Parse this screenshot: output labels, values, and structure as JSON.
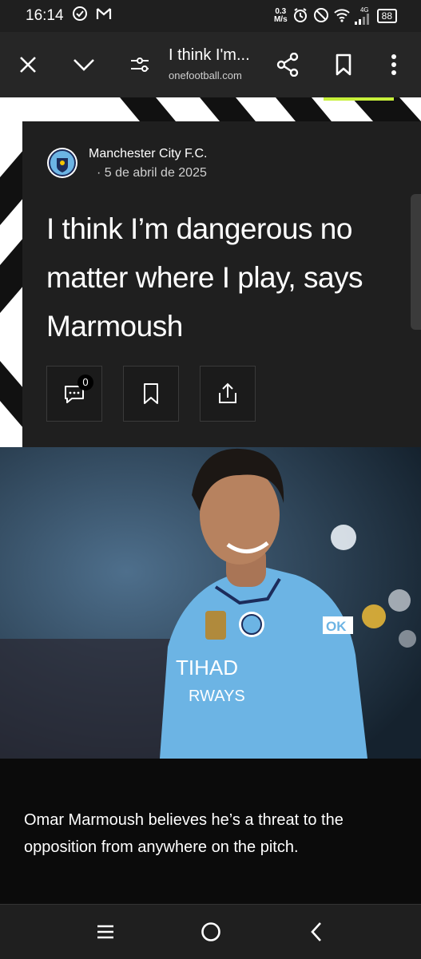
{
  "status_bar": {
    "time": "16:14",
    "speed_value": "0.3",
    "speed_unit": "M/s",
    "network": "4G",
    "battery": "88"
  },
  "toolbar": {
    "page_title": "I think I'm...",
    "url": "onefootball.com"
  },
  "article": {
    "source": "Manchester City F.C.",
    "date": "· 5 de abril de 2025",
    "headline": "I think I’m dangerous no matter where I play, says Marmoush",
    "comment_count": "0",
    "summary": "Omar Marmoush believes he’s a threat to the opposition from anywhere on the pitch.",
    "logo_text": "MANCHESTER CITY",
    "shirt_sponsor": "TIHAD",
    "shirt_sponsor_2": "RWAYS",
    "sleeve_text": "OK"
  },
  "colors": {
    "accent": "#c7f03a",
    "city_blue": "#6cb4e4",
    "card_bg": "#1f1f1f"
  }
}
